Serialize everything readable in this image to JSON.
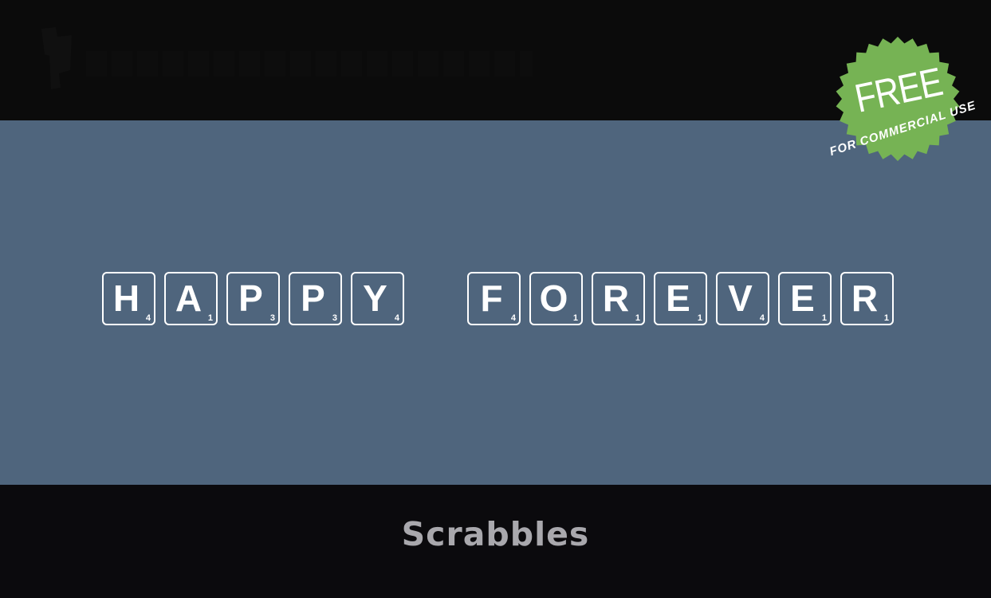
{
  "header": {
    "logo_icon": "site-logo-watermark"
  },
  "preview": {
    "background_color": "#4f657d",
    "text_color": "#ffffff",
    "words": [
      {
        "tiles": [
          {
            "letter": "H",
            "score": "4"
          },
          {
            "letter": "A",
            "score": "1"
          },
          {
            "letter": "P",
            "score": "3"
          },
          {
            "letter": "P",
            "score": "3"
          },
          {
            "letter": "Y",
            "score": "4"
          }
        ]
      },
      {
        "tiles": [
          {
            "letter": "F",
            "score": "4"
          },
          {
            "letter": "O",
            "score": "1"
          },
          {
            "letter": "R",
            "score": "1"
          },
          {
            "letter": "E",
            "score": "1"
          },
          {
            "letter": "V",
            "score": "4"
          },
          {
            "letter": "E",
            "score": "1"
          },
          {
            "letter": "R",
            "score": "1"
          }
        ]
      }
    ]
  },
  "badge": {
    "title": "FREE",
    "subtitle": "FOR COMMERCIAL USE",
    "color": "#76b354"
  },
  "footer": {
    "font_name": "Scrabbles"
  }
}
